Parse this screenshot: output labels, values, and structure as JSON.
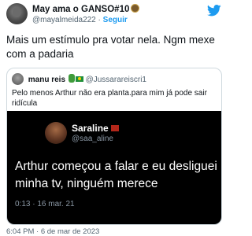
{
  "author": {
    "name": "May ama o GANSO#10",
    "handle": "@mayalmeida222",
    "separator": "·",
    "follow_label": "Seguir"
  },
  "tweet": {
    "text": "Mais um estímulo pra votar nela. Ngm mexe com a padaria",
    "timestamp": "6:04 PM · 6 de mar de 2023"
  },
  "quoted": {
    "name": "manu reis",
    "handle": "@Jussarareiscri1",
    "text": "Pelo menos Arthur não era planta.para mim já pode sair ridícula"
  },
  "media": {
    "name": "Saraline",
    "handle": "@saa_aline",
    "text_line1": "Arthur começou a falar e eu desliguei",
    "text_line2": "minha tv, ninguém merece",
    "date": "0:13 · 16 mar. 21"
  },
  "icons": {
    "brand": "twitter-bird-icon",
    "badge": "team-badge-icon"
  },
  "colors": {
    "accent": "#1d9bf0",
    "text": "#0f1419",
    "muted": "#536471",
    "media_bg": "#000000"
  }
}
